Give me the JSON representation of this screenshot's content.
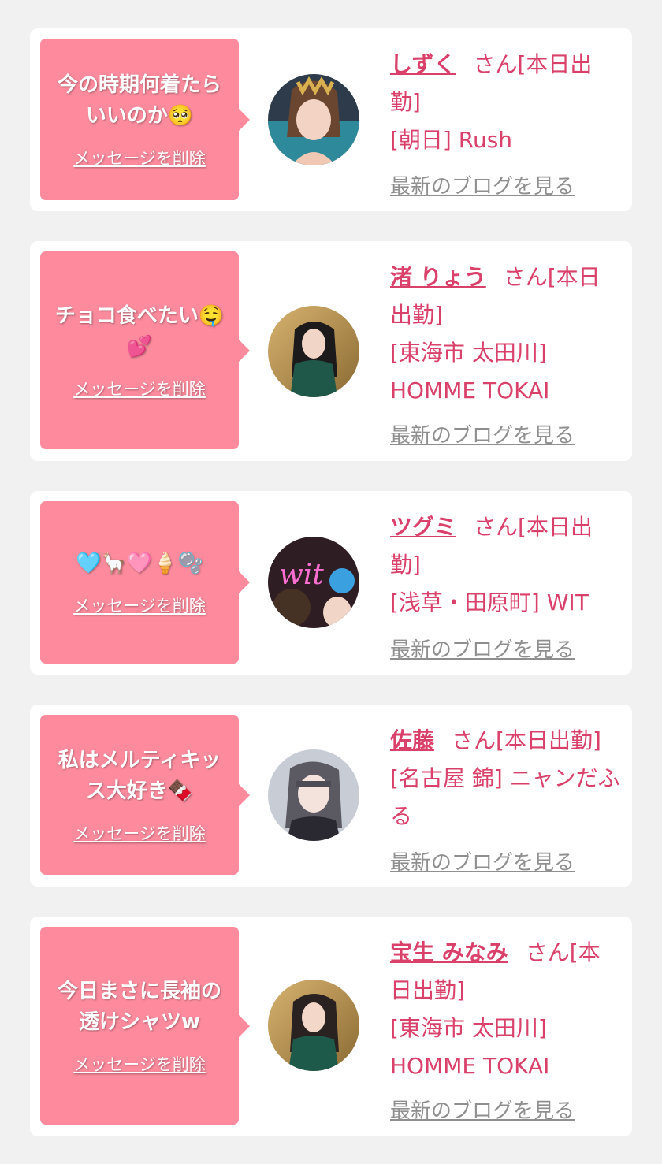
{
  "delete_label": "メッセージを削除",
  "blog_label": "最新のブログを見る",
  "colors": {
    "bubble": "#fd8b9d",
    "accent": "#d9406a",
    "link_gray": "#8f8f8f",
    "background": "#f1f1f1"
  },
  "cards": [
    {
      "message": "今の時期何着たらいいのか🥺",
      "name": "しずく",
      "suffix": "さん[本日出勤]",
      "shop": "[朝日] Rush"
    },
    {
      "message": "チョコ食べたい🤤💕",
      "name": "渚 りょう",
      "suffix": "さん[本日出勤]",
      "shop": "[東海市 太田川] HOMME TOKAI"
    },
    {
      "message": "🩵🦙🩷🍦🫧",
      "name": "ツグミ",
      "suffix": "さん[本日出勤]",
      "shop": "[浅草・田原町] WIT"
    },
    {
      "message": "私はメルティキッス大好き🍫",
      "name": "佐藤",
      "suffix": "さん[本日出勤]",
      "shop": "[名古屋 錦] ニャンだふる"
    },
    {
      "message": "今日まさに長袖の透けシャツw",
      "name": "宝生 みなみ",
      "suffix": "さん[本日出勤]",
      "shop": "[東海市 太田川] HOMME TOKAI"
    }
  ]
}
